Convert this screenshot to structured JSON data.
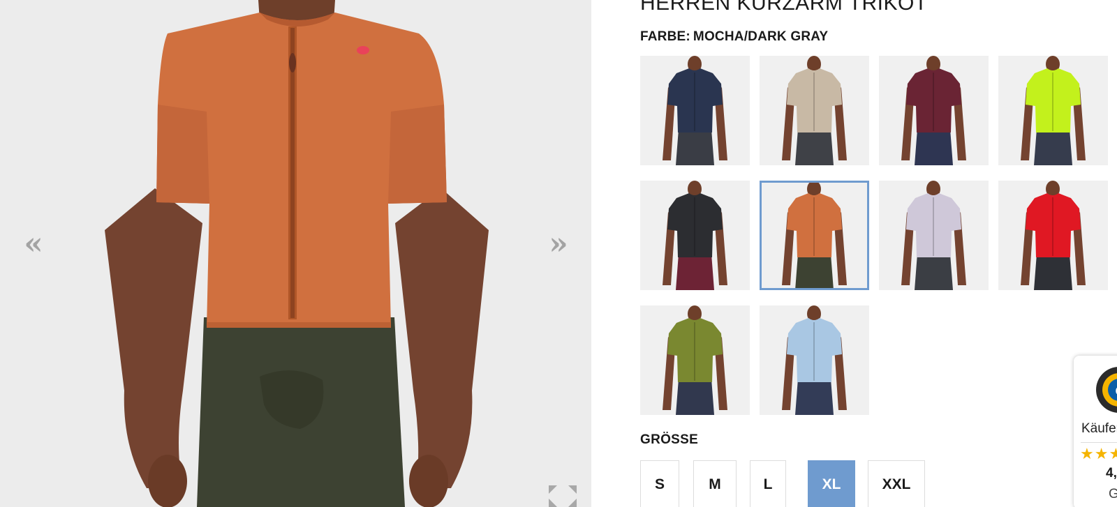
{
  "gallery": {
    "prev_glyph": "«",
    "next_glyph": "»",
    "main_jersey_color": "#d0703f",
    "main_shorts_color": "#3d4232",
    "logo_color": "#e9425a"
  },
  "product": {
    "title": "HERREN KURZARM TRIKOT",
    "color_prefix": "FARBE:",
    "color_value": "MOCHA/DARK GRAY"
  },
  "swatches": [
    {
      "jersey": "#2a3550",
      "shorts": "#3a3d45"
    },
    {
      "jersey": "#c8b9a5",
      "shorts": "#3f4147"
    },
    {
      "jersey": "#6a2434",
      "shorts": "#2e3552"
    },
    {
      "jersey": "#c3f11c",
      "shorts": "#363c4d"
    },
    {
      "jersey": "#2c2d31",
      "shorts": "#6d2335"
    },
    {
      "jersey": "#d0703f",
      "shorts": "#3d4232",
      "selected": true
    },
    {
      "jersey": "#cfc8d9",
      "shorts": "#3b3e44"
    },
    {
      "jersey": "#e01823",
      "shorts": "#2e3036"
    },
    {
      "jersey": "#7a8830",
      "shorts": "#31384e"
    },
    {
      "jersey": "#a9c7e3",
      "shorts": "#333c57"
    }
  ],
  "sizes": {
    "label": "GRÖSSE",
    "options": [
      "S",
      "M",
      "L",
      "XL",
      "XXL"
    ],
    "selected": "XL"
  },
  "trust_badge": {
    "label": "Käufer",
    "stars": "★★★",
    "rating": "4,",
    "sub": "G"
  }
}
